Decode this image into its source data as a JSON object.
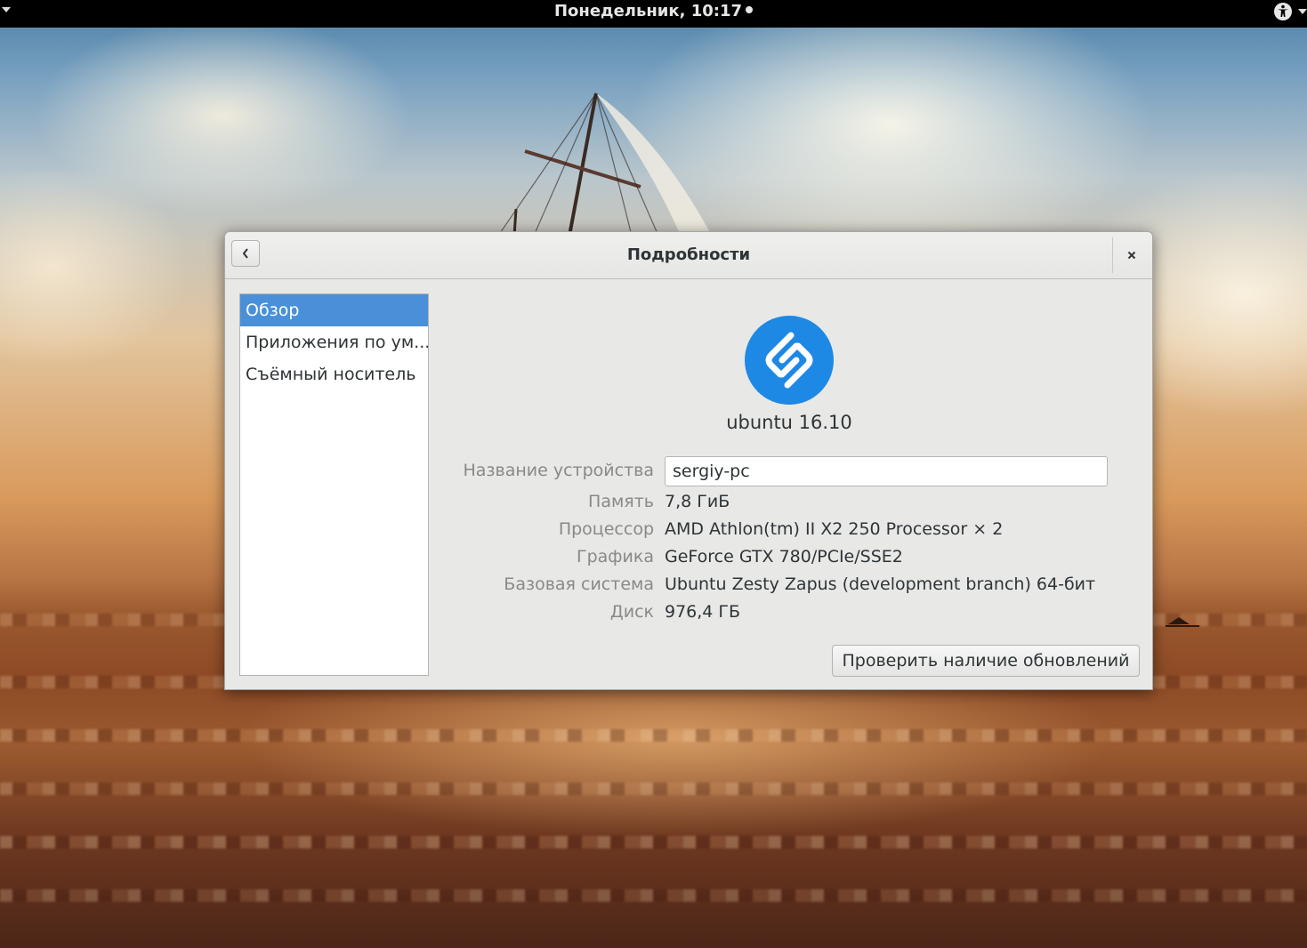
{
  "top_bar": {
    "clock": "Понедельник, 10:17",
    "icons": [
      "activities-menu-arrow",
      "accessibility-icon",
      "system-menu-arrow"
    ]
  },
  "dialog": {
    "title": "Подробности",
    "icons": {
      "back": "chevron-left-icon",
      "close": "close-icon"
    },
    "sidebar": {
      "items": [
        {
          "label": "Обзор",
          "selected": true
        },
        {
          "label": "Приложения по ум...",
          "selected": false
        },
        {
          "label": "Съёмный носитель",
          "selected": false
        }
      ]
    },
    "overview": {
      "distro_name": "ubuntu 16.10",
      "logo_icon": "distro-logo-icon",
      "device_name_label": "Название устройства",
      "device_name_value": "sergiy-pc",
      "rows": [
        {
          "label": "Память",
          "value": "7,8 ГиБ"
        },
        {
          "label": "Процессор",
          "value": "AMD Athlon(tm) II X2 250 Processor × 2"
        },
        {
          "label": "Графика",
          "value": "GeForce GTX 780/PCIe/SSE2"
        },
        {
          "label": "Базовая система",
          "value": "Ubuntu Zesty Zapus (development branch) 64-бит"
        },
        {
          "label": "Диск",
          "value": "976,4 ГБ"
        }
      ],
      "check_updates_button": "Проверить наличие обновлений"
    }
  },
  "colors": {
    "accent": "#4a90d9",
    "logo": "#1e88e5",
    "top_bar": "#000000",
    "dialog_bg": "#e8e8e7"
  }
}
